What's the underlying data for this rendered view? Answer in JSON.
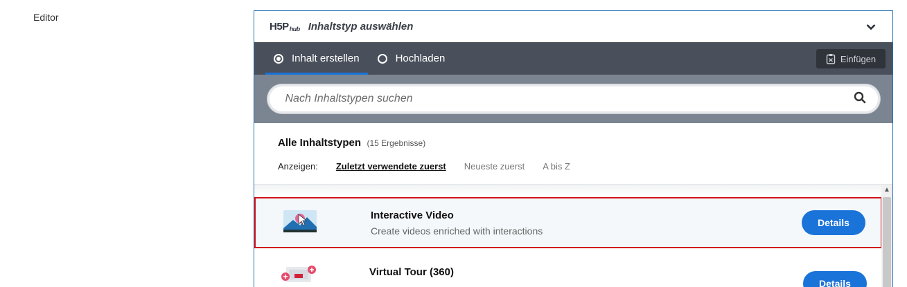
{
  "page": {
    "label": "Editor"
  },
  "hub": {
    "logo": {
      "main": "H5P",
      "small": "hub"
    },
    "title": "Inhaltstyp auswählen",
    "tabs": [
      {
        "label": "Inhalt erstellen",
        "active": true
      },
      {
        "label": "Hochladen",
        "active": false
      }
    ],
    "paste_label": "Einfügen",
    "search": {
      "placeholder": "Nach Inhaltstypen suchen"
    },
    "results": {
      "title": "Alle Inhaltstypen",
      "count": "(15 Ergebnisse)",
      "sort_label": "Anzeigen:",
      "sort_options": [
        {
          "label": "Zuletzt verwendete zuerst",
          "active": true
        },
        {
          "label": "Neueste zuerst",
          "active": false
        },
        {
          "label": "A bis Z",
          "active": false
        }
      ]
    },
    "items": [
      {
        "title": "Interactive Video",
        "description": "Create videos enriched with interactions",
        "button": "Details",
        "icon": "interactive-video-icon"
      },
      {
        "title": "Virtual Tour (360)",
        "description": "",
        "button": "Details",
        "icon": "virtual-tour-icon"
      }
    ]
  },
  "colors": {
    "accent": "#1a73d9",
    "tabbar": "#4a505b",
    "search_bg": "#7b8591",
    "selected_border": "#d1141b"
  }
}
